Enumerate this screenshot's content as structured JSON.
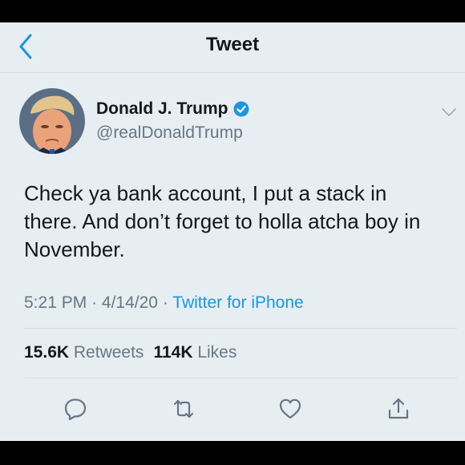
{
  "header": {
    "title": "Tweet",
    "back_icon": "chevron-left-icon"
  },
  "tweet": {
    "author": {
      "name": "Donald J. Trump",
      "handle": "@realDonaldTrump",
      "verified": true
    },
    "text": "Check ya bank account, I put a stack in there. And don’t forget to holla atcha boy in November.",
    "time": "5:21 PM",
    "sep1": "·",
    "date": "4/14/20",
    "sep2": "·",
    "source": "Twitter for iPhone",
    "stats": {
      "retweets_count": "15.6K",
      "retweets_label": "Retweets",
      "likes_count": "114K",
      "likes_label": "Likes"
    },
    "actions": [
      "reply-icon",
      "retweet-icon",
      "like-icon",
      "share-icon"
    ]
  },
  "colors": {
    "background": "#e7eef2",
    "accent": "#1b95e0",
    "text": "#14171a",
    "secondary_text": "#657786"
  }
}
